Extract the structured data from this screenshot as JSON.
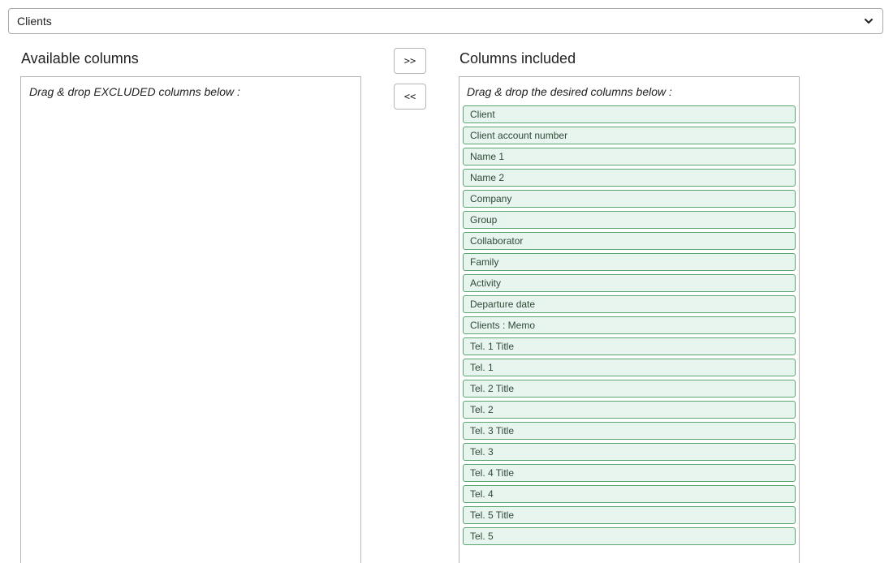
{
  "entity_select": {
    "value": "Clients"
  },
  "available": {
    "title": "Available columns",
    "hint": "Drag & drop EXCLUDED columns below :",
    "items": []
  },
  "buttons": {
    "add_label": ">>",
    "remove_label": "<<"
  },
  "included": {
    "title": "Columns included",
    "hint": "Drag & drop the desired columns below :",
    "items": [
      "Client",
      "Client account number",
      "Name 1",
      "Name 2",
      "Company",
      "Group",
      "Collaborator",
      "Family",
      "Activity",
      "Departure date",
      "Clients : Memo",
      "Tel. 1 Title",
      "Tel. 1",
      "Tel. 2 Title",
      "Tel. 2",
      "Tel. 3 Title",
      "Tel. 3",
      "Tel. 4 Title",
      "Tel. 4",
      "Tel. 5 Title",
      "Tel. 5"
    ]
  },
  "colors": {
    "item_border": "#58a66f",
    "item_background": "#e8f5ee",
    "item_text": "#2e4a38"
  },
  "icons": {
    "select_chevron": "chevron-down-icon"
  }
}
